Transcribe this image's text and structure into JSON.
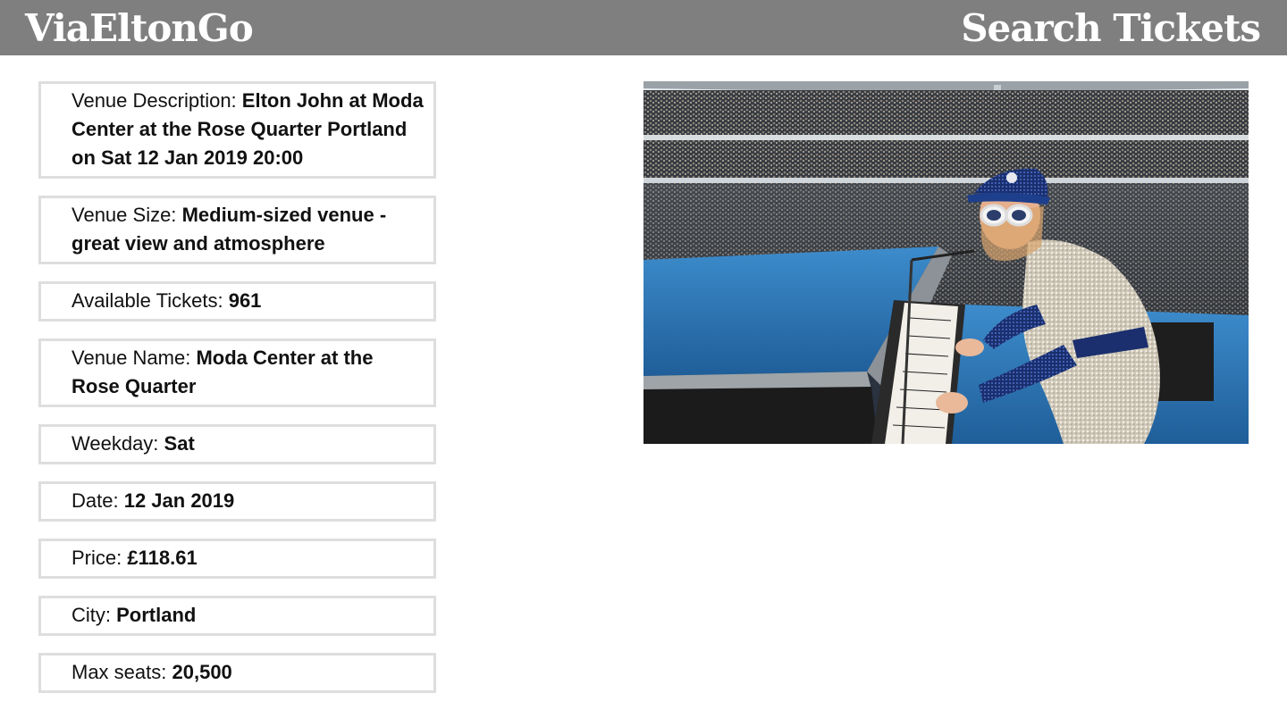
{
  "header": {
    "brand": "ViaEltonGo",
    "search_link": "Search Tickets"
  },
  "details": [
    {
      "label": "Venue Description:",
      "value": "Elton John at Moda Center at the Rose Quarter Portland on Sat 12 Jan 2019 20:00"
    },
    {
      "label": "Venue Size:",
      "value": "Medium-sized venue - great view and atmosphere"
    },
    {
      "label": "Available Tickets:",
      "value": "961"
    },
    {
      "label": "Venue Name:",
      "value": "Moda Center at the Rose Quarter"
    },
    {
      "label": "Weekday:",
      "value": "Sat"
    },
    {
      "label": "Date:",
      "value": "12 Jan 2019"
    },
    {
      "label": "Price:",
      "value": "£118.61"
    },
    {
      "label": "City:",
      "value": "Portland"
    },
    {
      "label": "Max seats:",
      "value": "20,500"
    }
  ],
  "photo": {
    "subject": "pianist-performing-in-stadium",
    "colors": {
      "sky": "#e8ecef",
      "crowd": "#3b3f45",
      "carpet": "#2f78b8",
      "piano": "#1a1a1a",
      "outfit": "#d9d3c4",
      "cap": "#1e3f8c"
    }
  }
}
